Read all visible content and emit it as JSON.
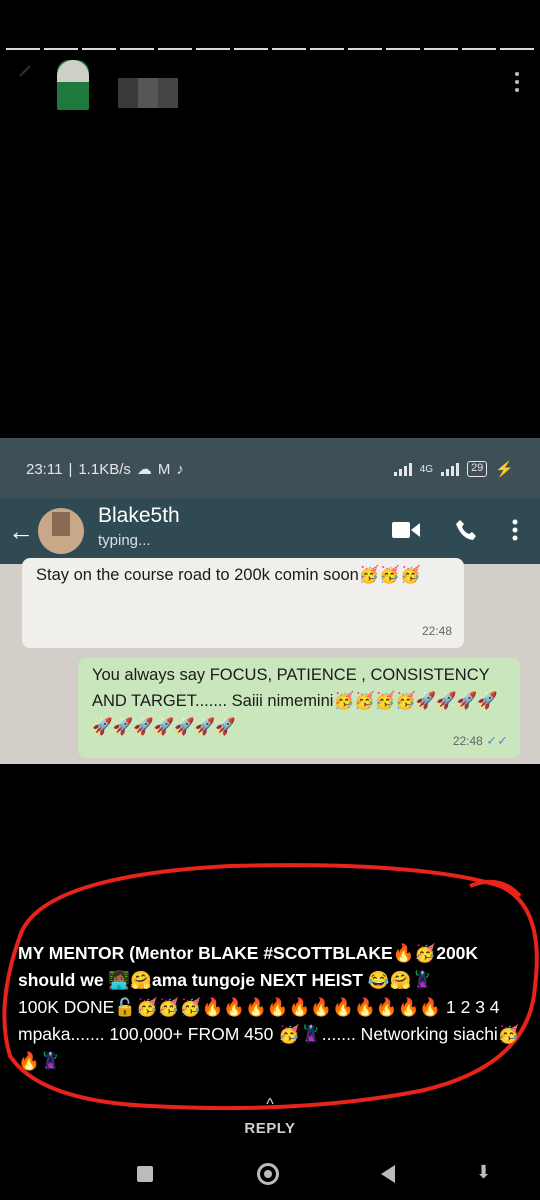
{
  "story": {
    "segments": 14,
    "reply_label": "REPLY"
  },
  "embedded": {
    "status": {
      "time": "23:11",
      "speed": "1.1KB/s",
      "network": "4G",
      "battery": "29"
    },
    "chat": {
      "name": "Blake5th",
      "status": "typing...",
      "incoming": {
        "text": "Stay on the course road to 200k comin soon🥳🥳🥳",
        "time": "22:48"
      },
      "outgoing": {
        "text": "You always say FOCUS, PATIENCE , CONSISTENCY AND TARGET....... Saiii nimemini🥳🥳🥳🥳🚀🚀🚀🚀🚀🚀🚀🚀🚀🚀🚀",
        "time": "22:48",
        "ticks": "✓✓"
      }
    }
  },
  "caption": {
    "line1": "MY MENTOR (Mentor BLAKE #SCOTTBLAKE🔥🥳200K should we 👩🏾‍💻🤗ama tungoje NEXT HEIST 😂🤗🦹",
    "line2": "100K DONE🔓🥳🥳🥳🔥🔥🔥🔥🔥🔥🔥🔥🔥🔥🔥 1 2 3 4 mpaka....... 100,000+ FROM 450 🥳🦹....... Networking siachi🥳🔥🦹"
  },
  "colors": {
    "accent_red": "#e8231a",
    "chat_header": "#2f4a52",
    "outgoing_bubble": "#c9e6bd"
  },
  "icons": [
    "more-vert-icon",
    "arrow-back-icon",
    "video-call-icon",
    "phone-icon",
    "chevron-up-icon",
    "nav-recents-icon",
    "nav-home-icon",
    "nav-back-icon"
  ]
}
